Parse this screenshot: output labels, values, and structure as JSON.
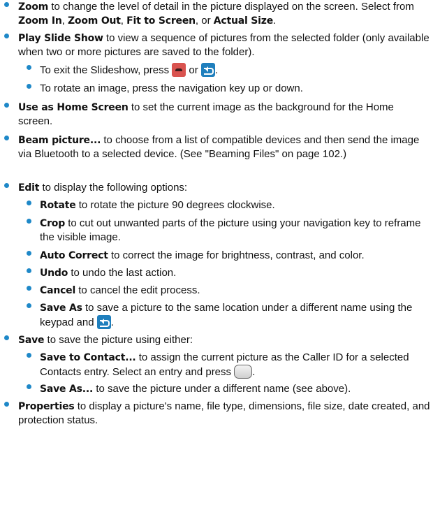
{
  "accent_color": "#1e88c8",
  "zoom": {
    "label": "Zoom",
    "text1": " to change the level of detail in the picture displayed on the screen. Select from ",
    "opt1": "Zoom In",
    "sep1": ", ",
    "opt2": "Zoom Out",
    "sep2": ", ",
    "opt3": "Fit to Screen",
    "sep3": ", or ",
    "opt4": "Actual Size",
    "end": "."
  },
  "slideshow": {
    "label": "Play Slide Show",
    "text": " to view a sequence of pictures from the selected folder (only available when two or more pictures are saved to the folder).",
    "exit_pre": "To exit the Slideshow, press ",
    "exit_mid": " or ",
    "exit_end": ".",
    "rotate": "To rotate an image, press the navigation key up or down."
  },
  "home": {
    "label": "Use as Home Screen",
    "text": " to set the current image as the background for the Home screen."
  },
  "beam": {
    "label": "Beam picture...",
    "text": " to choose from a list of compatible devices and then send the image via Bluetooth to a selected device. (See \"Beaming Files\" on page 102.)"
  },
  "edit": {
    "label": "Edit",
    "text": " to display the following options:",
    "items": [
      {
        "label": "Rotate",
        "text": " to rotate the picture 90 degrees clockwise."
      },
      {
        "label": "Crop",
        "text": " to cut out unwanted parts of the picture using your navigation key to reframe the visible image."
      },
      {
        "label": "Auto Correct",
        "text": " to correct the image for brightness, contrast, and color."
      },
      {
        "label": "Undo",
        "text": " to undo the last action."
      },
      {
        "label": "Cancel",
        "text": " to cancel the edit process."
      },
      {
        "label": "Save As",
        "text": " to save a picture to the same location under a different name using the keypad and ",
        "end": "."
      }
    ]
  },
  "save": {
    "label": "Save",
    "text": " to save the picture using either:",
    "contact_label": "Save to Contact...",
    "contact_text": " to assign the current picture as the Caller ID for a selected Contacts entry. Select an entry and press ",
    "contact_end": ".",
    "saveas_label": "Save As...",
    "saveas_text": " to save the picture under a different name (see above)."
  },
  "properties": {
    "label": "Properties",
    "text": " to display a picture's name, file type, dimensions, file size, date created, and protection status."
  },
  "icons": {
    "end_key": "end-call-key-icon",
    "back_key": "back-key-icon",
    "ok_key": "ok-key-icon"
  }
}
